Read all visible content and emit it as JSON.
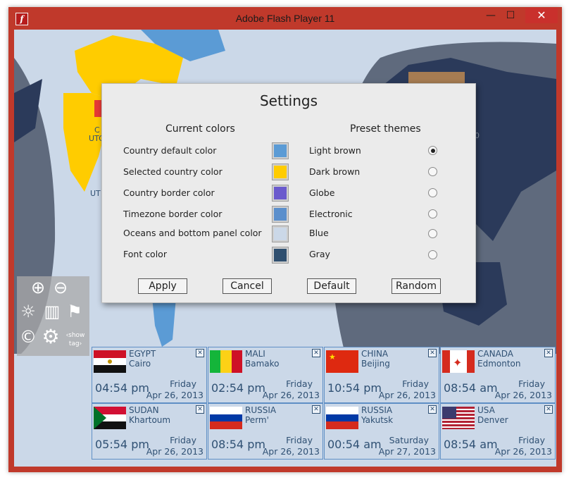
{
  "window": {
    "title": "Adobe Flash Player 11",
    "min_symbol": "—",
    "max_symbol": "☐",
    "close_symbol": "✕",
    "app_icon_glyph": "f"
  },
  "map_labels": {
    "left_code_1": "C",
    "left_code_2": "UTC",
    "left_code_3": "UT",
    "right_mark": "0"
  },
  "tools": {
    "items": [
      {
        "name": "zoom-in-icon",
        "glyph": "⊕"
      },
      {
        "name": "zoom-out-icon",
        "glyph": "⊖"
      },
      {
        "name": "daylight-icon",
        "glyph": "☼"
      },
      {
        "name": "cities-icon",
        "glyph": "▥"
      },
      {
        "name": "signpost-icon",
        "glyph": "⚑"
      },
      {
        "name": "copyright-icon",
        "glyph": "©"
      },
      {
        "name": "settings-gear-icon",
        "glyph": "⚙"
      },
      {
        "name": "show-tag-icon",
        "glyph": "‹show tag›"
      }
    ]
  },
  "settings": {
    "title": "Settings",
    "current_colors_header": "Current colors",
    "preset_themes_header": "Preset themes",
    "colors": [
      {
        "label": "Country default color",
        "color": "#5b9bd5"
      },
      {
        "label": "Selected country color",
        "color": "#ffcc00"
      },
      {
        "label": "Country border color",
        "color": "#6a5acd"
      },
      {
        "label": "Timezone border color",
        "color": "#5b8fcc"
      },
      {
        "label": "Oceans and bottom panel color",
        "color": "#cbd8e8"
      },
      {
        "label": "Font color",
        "color": "#2f4f6f"
      }
    ],
    "themes": [
      {
        "label": "Light brown",
        "selected": true
      },
      {
        "label": "Dark brown",
        "selected": false
      },
      {
        "label": "Globe",
        "selected": false
      },
      {
        "label": "Electronic",
        "selected": false
      },
      {
        "label": "Blue",
        "selected": false
      },
      {
        "label": "Gray",
        "selected": false
      }
    ],
    "buttons": {
      "apply": "Apply",
      "cancel": "Cancel",
      "default": "Default",
      "random": "Random"
    }
  },
  "clocks": [
    {
      "country": "EGYPT",
      "city": "Cairo",
      "time": "04:54 pm",
      "day": "Friday",
      "date": "Apr 26, 2013",
      "flag": "egypt"
    },
    {
      "country": "MALI",
      "city": "Bamako",
      "time": "02:54 pm",
      "day": "Friday",
      "date": "Apr 26, 2013",
      "flag": "mali"
    },
    {
      "country": "CHINA",
      "city": "Beijing",
      "time": "10:54 pm",
      "day": "Friday",
      "date": "Apr 26, 2013",
      "flag": "china"
    },
    {
      "country": "CANADA",
      "city": "Edmonton",
      "time": "08:54 am",
      "day": "Friday",
      "date": "Apr 26, 2013",
      "flag": "canada"
    },
    {
      "country": "SUDAN",
      "city": "Khartoum",
      "time": "05:54 pm",
      "day": "Friday",
      "date": "Apr 26, 2013",
      "flag": "sudan"
    },
    {
      "country": "RUSSIA",
      "city": "Perm'",
      "time": "08:54 pm",
      "day": "Friday",
      "date": "Apr 26, 2013",
      "flag": "russia"
    },
    {
      "country": "RUSSIA",
      "city": "Yakutsk",
      "time": "00:54 am",
      "day": "Saturday",
      "date": "Apr 27, 2013",
      "flag": "russia"
    },
    {
      "country": "USA",
      "city": "Denver",
      "time": "08:54 am",
      "day": "Friday",
      "date": "Apr 26, 2013",
      "flag": "usa"
    }
  ],
  "close_glyph": "✕"
}
